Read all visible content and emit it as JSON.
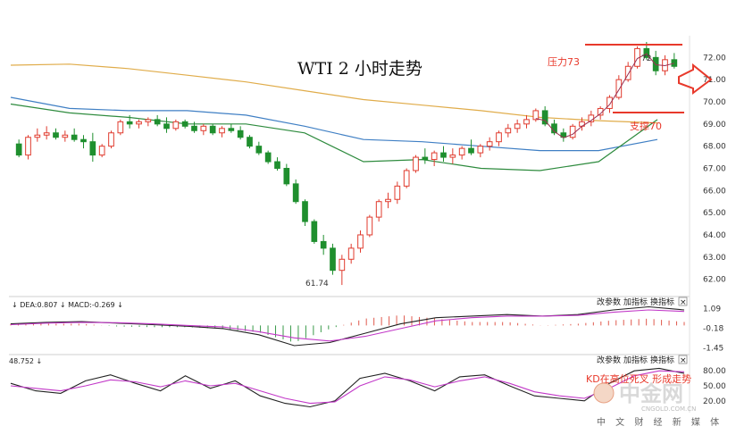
{
  "chart_data": {
    "type": "candlestick",
    "title": "WTI 2 小时走势",
    "ylim": [
      61.3,
      72.9
    ],
    "y_ticks": [
      72.0,
      71.0,
      70.0,
      69.0,
      68.0,
      67.0,
      66.0,
      65.0,
      64.0,
      63.0,
      62.0
    ],
    "annotations": {
      "resistance": {
        "text": "压力73",
        "value": 73
      },
      "support": {
        "text": "支撑70",
        "value": 70
      },
      "low_point": {
        "text": "61.74",
        "value": 61.74
      },
      "peak_label": "72",
      "kd_note": "KD在高位死叉 形成走势"
    },
    "candles": [
      [
        68.1,
        68.3,
        67.5,
        67.6
      ],
      [
        67.6,
        68.5,
        67.4,
        68.4
      ],
      [
        68.4,
        68.8,
        68.2,
        68.5
      ],
      [
        68.5,
        68.9,
        68.3,
        68.6
      ],
      [
        68.6,
        68.8,
        68.3,
        68.4
      ],
      [
        68.4,
        68.7,
        68.2,
        68.5
      ],
      [
        68.5,
        68.8,
        68.2,
        68.3
      ],
      [
        68.3,
        68.5,
        67.9,
        68.2
      ],
      [
        68.2,
        68.6,
        67.3,
        67.6
      ],
      [
        67.6,
        68.1,
        67.5,
        68.0
      ],
      [
        68.0,
        68.7,
        67.9,
        68.6
      ],
      [
        68.6,
        69.2,
        68.5,
        69.1
      ],
      [
        69.1,
        69.4,
        68.8,
        69.0
      ],
      [
        69.0,
        69.2,
        68.8,
        69.1
      ],
      [
        69.1,
        69.3,
        68.9,
        69.2
      ],
      [
        69.2,
        69.4,
        68.9,
        69.0
      ],
      [
        69.0,
        69.3,
        68.6,
        68.8
      ],
      [
        68.8,
        69.2,
        68.7,
        69.1
      ],
      [
        69.1,
        69.2,
        68.8,
        68.9
      ],
      [
        68.9,
        69.1,
        68.6,
        68.7
      ],
      [
        68.7,
        69.0,
        68.5,
        68.9
      ],
      [
        68.9,
        69.0,
        68.5,
        68.6
      ],
      [
        68.6,
        68.9,
        68.4,
        68.8
      ],
      [
        68.8,
        69.0,
        68.6,
        68.7
      ],
      [
        68.7,
        68.9,
        68.3,
        68.4
      ],
      [
        68.4,
        68.5,
        67.9,
        68.0
      ],
      [
        68.0,
        68.2,
        67.6,
        67.7
      ],
      [
        67.7,
        67.8,
        67.2,
        67.3
      ],
      [
        67.3,
        67.5,
        66.9,
        67.0
      ],
      [
        67.0,
        67.2,
        66.2,
        66.3
      ],
      [
        66.3,
        66.5,
        65.4,
        65.5
      ],
      [
        65.5,
        65.6,
        64.4,
        64.6
      ],
      [
        64.6,
        64.7,
        63.6,
        63.7
      ],
      [
        63.7,
        64.0,
        63.1,
        63.4
      ],
      [
        63.4,
        63.6,
        62.2,
        62.4
      ],
      [
        62.4,
        63.1,
        61.74,
        62.9
      ],
      [
        62.9,
        63.6,
        62.7,
        63.4
      ],
      [
        63.4,
        64.2,
        63.2,
        64.0
      ],
      [
        64.0,
        64.9,
        63.9,
        64.8
      ],
      [
        64.8,
        65.6,
        64.6,
        65.5
      ],
      [
        65.5,
        65.9,
        65.2,
        65.6
      ],
      [
        65.6,
        66.4,
        65.4,
        66.2
      ],
      [
        66.2,
        67.0,
        66.1,
        66.9
      ],
      [
        66.9,
        67.6,
        66.8,
        67.5
      ],
      [
        67.5,
        67.9,
        67.2,
        67.4
      ],
      [
        67.4,
        67.8,
        67.1,
        67.7
      ],
      [
        67.7,
        68.0,
        67.3,
        67.5
      ],
      [
        67.5,
        67.9,
        67.2,
        67.6
      ],
      [
        67.6,
        68.0,
        67.4,
        67.9
      ],
      [
        67.9,
        68.3,
        67.6,
        67.7
      ],
      [
        67.7,
        68.1,
        67.5,
        68.0
      ],
      [
        68.0,
        68.4,
        67.8,
        68.2
      ],
      [
        68.2,
        68.7,
        68.0,
        68.6
      ],
      [
        68.6,
        69.0,
        68.4,
        68.8
      ],
      [
        68.8,
        69.2,
        68.6,
        69.0
      ],
      [
        69.0,
        69.4,
        68.8,
        69.2
      ],
      [
        69.2,
        69.7,
        69.1,
        69.6
      ],
      [
        69.6,
        69.8,
        68.9,
        69.0
      ],
      [
        69.0,
        69.2,
        68.5,
        68.6
      ],
      [
        68.6,
        68.8,
        68.2,
        68.4
      ],
      [
        68.4,
        69.0,
        68.3,
        68.9
      ],
      [
        68.9,
        69.3,
        68.7,
        69.1
      ],
      [
        69.1,
        69.6,
        68.9,
        69.4
      ],
      [
        69.4,
        69.8,
        69.2,
        69.7
      ],
      [
        69.7,
        70.3,
        69.5,
        70.2
      ],
      [
        70.2,
        71.2,
        70.1,
        71.0
      ],
      [
        71.0,
        71.8,
        70.9,
        71.6
      ],
      [
        71.6,
        72.5,
        71.5,
        72.4
      ],
      [
        72.4,
        72.7,
        71.9,
        72.0
      ],
      [
        72.0,
        72.3,
        71.2,
        71.4
      ],
      [
        71.4,
        72.1,
        71.2,
        71.9
      ],
      [
        71.9,
        72.2,
        71.5,
        71.6
      ]
    ],
    "moving_averages": [
      {
        "color": "#e0ac4a",
        "values": [
          71.65,
          71.7,
          71.5,
          71.2,
          70.9,
          70.5,
          70.1,
          69.85,
          69.6,
          69.3,
          69.15,
          69.05
        ]
      },
      {
        "color": "#3f7fc4",
        "values": [
          70.2,
          69.7,
          69.6,
          69.6,
          69.4,
          68.9,
          68.3,
          68.2,
          68.0,
          67.8,
          67.8,
          68.3
        ]
      },
      {
        "color": "#2e8b3e",
        "values": [
          69.9,
          69.5,
          69.3,
          69.0,
          69.0,
          68.6,
          67.3,
          67.4,
          67.0,
          66.9,
          67.3,
          69.2
        ]
      }
    ],
    "macd": {
      "label": "DEA:0.807",
      "label2": "MACD:-0.269",
      "y_ticks": [
        1.09,
        -0.18,
        -1.45
      ],
      "ylim": [
        -1.7,
        1.4
      ],
      "dif": [
        0.1,
        0.2,
        0.25,
        0.15,
        0.05,
        -0.05,
        -0.2,
        -0.6,
        -1.3,
        -1.1,
        -0.5,
        0.1,
        0.5,
        0.6,
        0.7,
        0.6,
        0.7,
        1.0,
        1.2,
        1.0
      ],
      "dea": [
        0.05,
        0.15,
        0.2,
        0.18,
        0.1,
        0.0,
        -0.1,
        -0.4,
        -0.8,
        -1.0,
        -0.7,
        -0.2,
        0.3,
        0.5,
        0.6,
        0.6,
        0.65,
        0.85,
        1.0,
        0.9
      ]
    },
    "kd": {
      "label": "48.752",
      "y_ticks": [
        80.0,
        50.0,
        20.0
      ],
      "ylim": [
        0,
        100
      ],
      "k": [
        55,
        40,
        35,
        60,
        72,
        55,
        40,
        70,
        45,
        60,
        30,
        15,
        8,
        20,
        65,
        75,
        60,
        40,
        68,
        72,
        50,
        30,
        25,
        20,
        55,
        80,
        85,
        75
      ],
      "d": [
        50,
        45,
        40,
        50,
        62,
        58,
        48,
        60,
        50,
        55,
        40,
        25,
        15,
        18,
        50,
        68,
        62,
        48,
        60,
        68,
        55,
        38,
        30,
        25,
        45,
        70,
        80,
        78
      ]
    }
  },
  "buttons": [
    "改参数",
    "加指标",
    "换指标"
  ],
  "close_glyph": "×",
  "watermark": {
    "brand": "中金网",
    "url": "CNGOLD.COM.CN",
    "tagline": "中 文 财 经 新 媒 体"
  }
}
